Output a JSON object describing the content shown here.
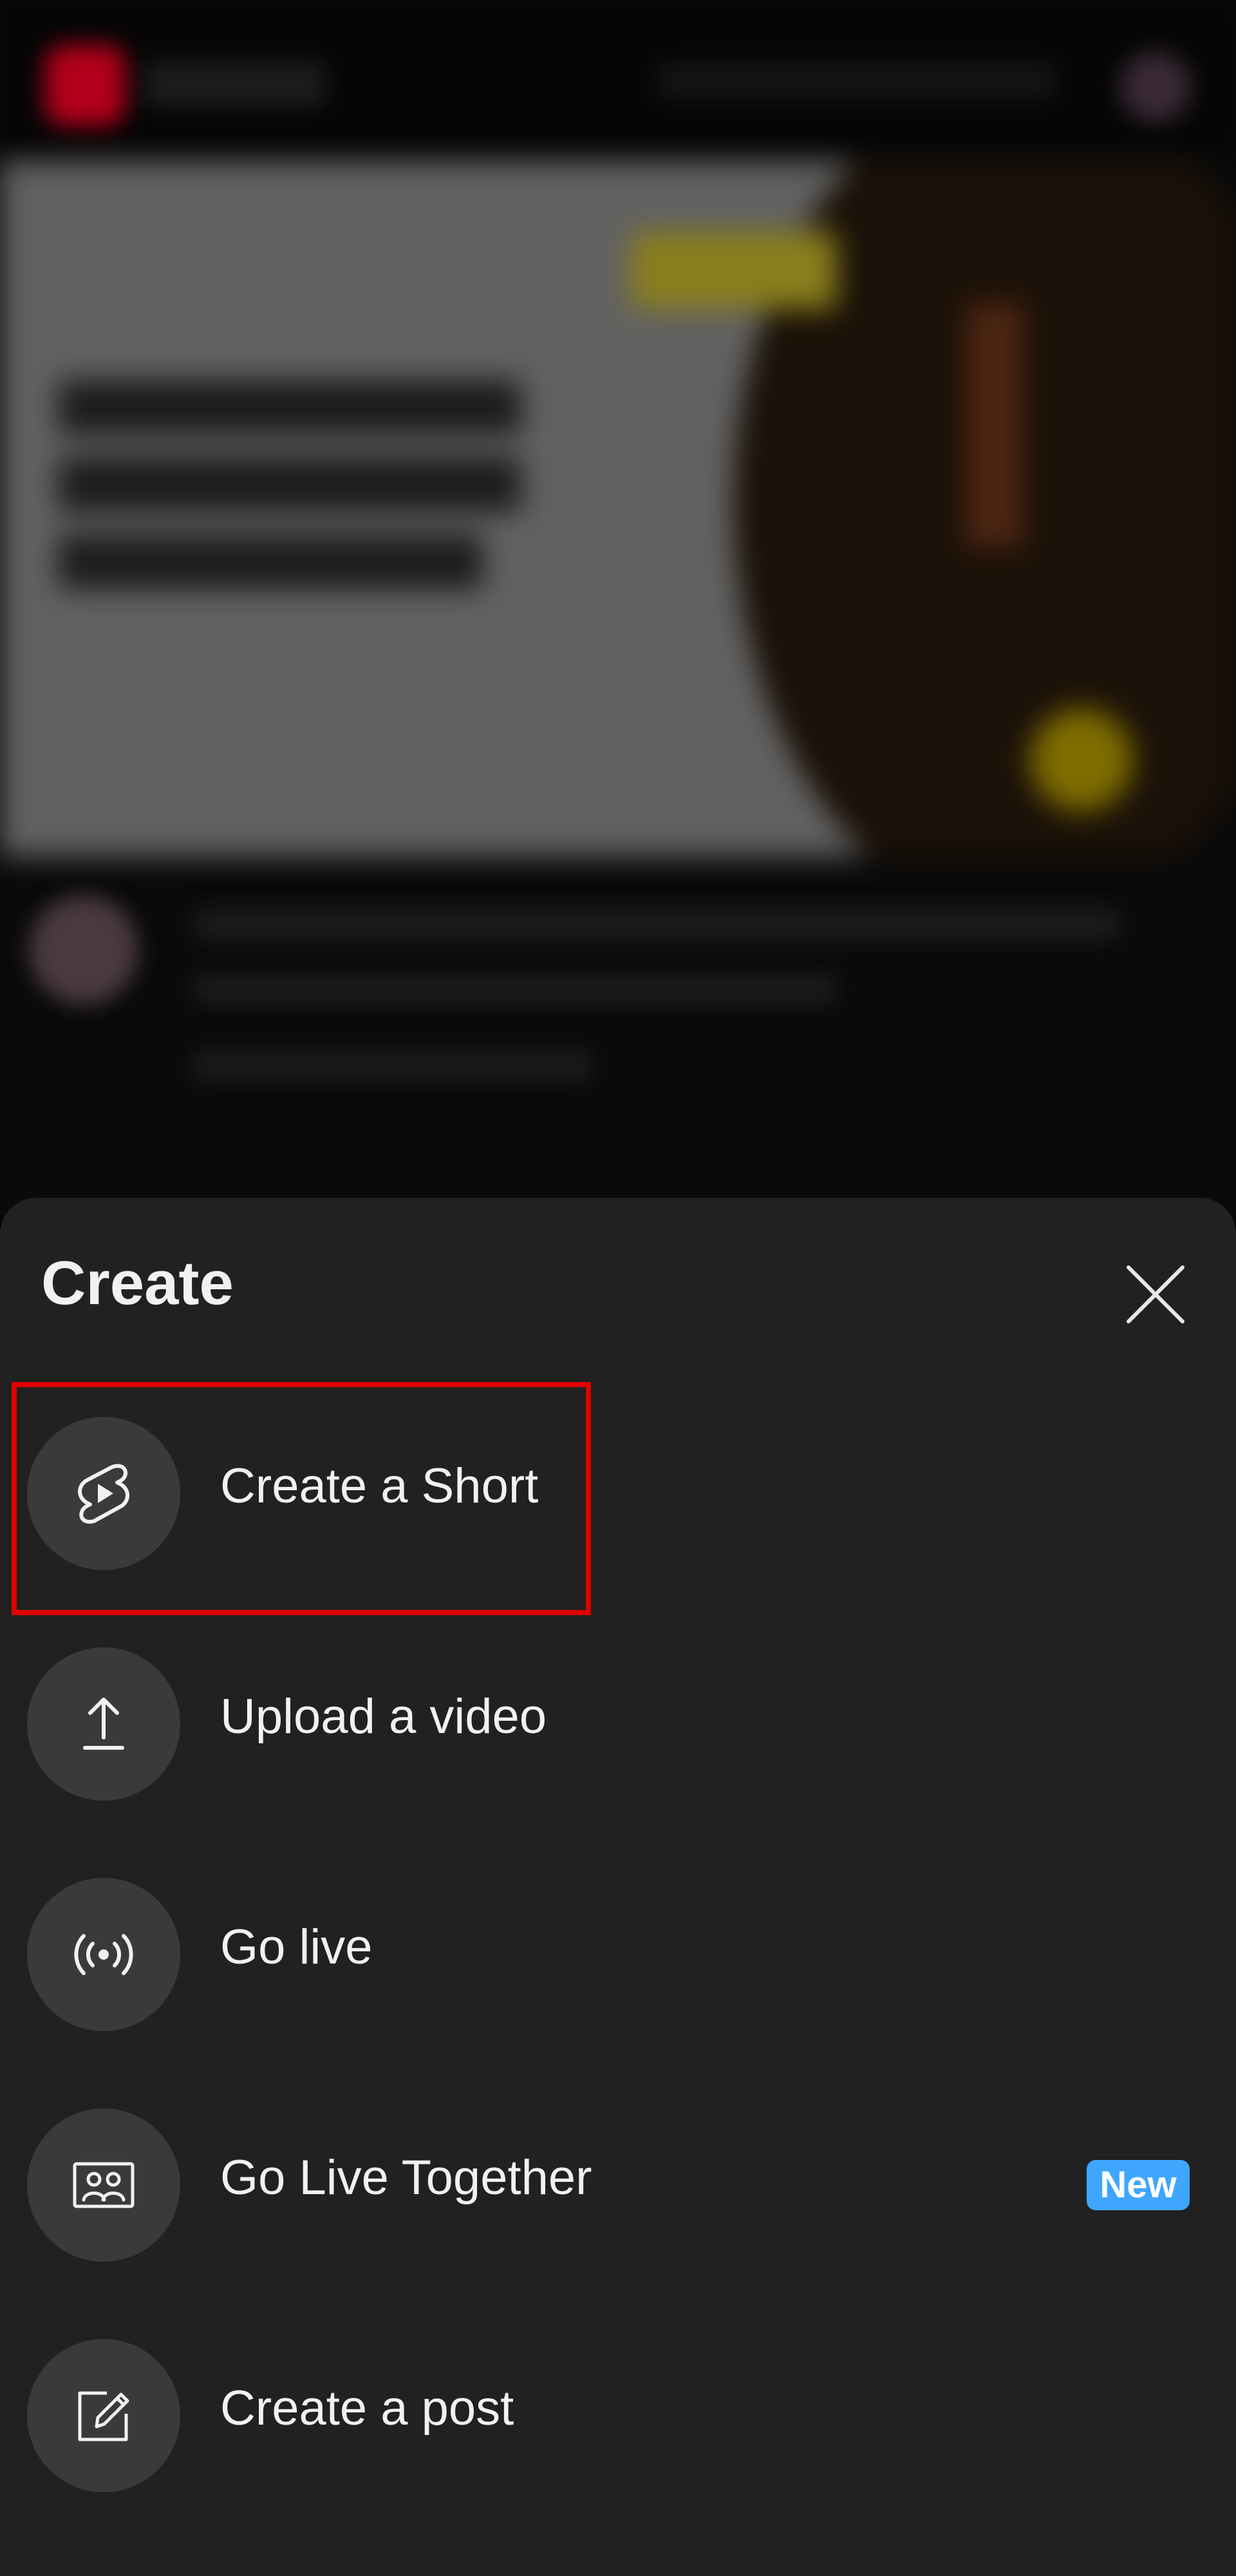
{
  "sheet": {
    "title": "Create",
    "close_icon": "close-icon",
    "items": [
      {
        "label": "Create a Short",
        "icon": "shorts-icon",
        "highlighted": true
      },
      {
        "label": "Upload a video",
        "icon": "upload-icon"
      },
      {
        "label": "Go live",
        "icon": "live-broadcast-icon"
      },
      {
        "label": "Go Live Together",
        "icon": "people-frame-icon",
        "badge": "New"
      },
      {
        "label": "Create a post",
        "icon": "edit-post-icon"
      }
    ]
  },
  "colors": {
    "sheet_background": "#212121",
    "icon_circle": "#3a3a3a",
    "text": "#f1f1f1",
    "badge": "#3ea6ff",
    "highlight_outline": "#e00000"
  }
}
